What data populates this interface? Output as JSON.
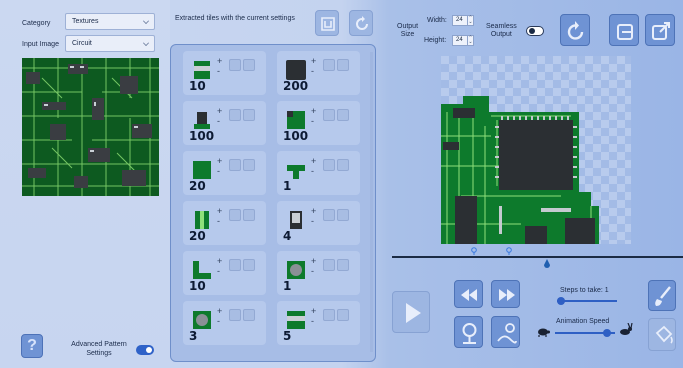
{
  "sidebar": {
    "category_label": "Category",
    "category_value": "Textures",
    "input_label": "Input Image",
    "input_value": "Circuit",
    "advanced_label_line1": "Advanced Pattern",
    "advanced_label_line2": "Settings",
    "advanced_on": true
  },
  "tiles": {
    "title": "Extracted tiles with the current settings",
    "items": [
      {
        "count": "10",
        "plus": "+",
        "minus": "-"
      },
      {
        "count": "200",
        "plus": "+",
        "minus": "-"
      },
      {
        "count": "100",
        "plus": "+",
        "minus": "-"
      },
      {
        "count": "100",
        "plus": "+",
        "minus": "-"
      },
      {
        "count": "20",
        "plus": "+",
        "minus": "-"
      },
      {
        "count": "1",
        "plus": "+",
        "minus": "-"
      },
      {
        "count": "20",
        "plus": "+",
        "minus": "-"
      },
      {
        "count": "4",
        "plus": "+",
        "minus": "-"
      },
      {
        "count": "10",
        "plus": "+",
        "minus": "-"
      },
      {
        "count": "1",
        "plus": "+",
        "minus": "-"
      },
      {
        "count": "3",
        "plus": "+",
        "minus": "-"
      },
      {
        "count": "5",
        "plus": "+",
        "minus": "-"
      }
    ]
  },
  "output": {
    "size_label_1": "Output",
    "size_label_2": "Size",
    "width_label": "Width:",
    "width_value": "24",
    "height_label": "Height:",
    "height_value": "24",
    "seamless_label_1": "Seamless",
    "seamless_label_2": "Output",
    "seamless_on": false
  },
  "controls": {
    "steps_label": "Steps to take: 1",
    "steps_value": 1,
    "speed_label": "Animation Speed",
    "speed_fraction": 0.85
  },
  "colors": {
    "accent": "#2e5fc4",
    "button": "#6f93d4",
    "pcb_green": "#0e7a2a",
    "pcb_dark": "#2b2f33"
  },
  "icons": {
    "help": "?",
    "play": "play-icon",
    "rewind": "rewind-icon",
    "forward": "fast-forward-icon"
  }
}
